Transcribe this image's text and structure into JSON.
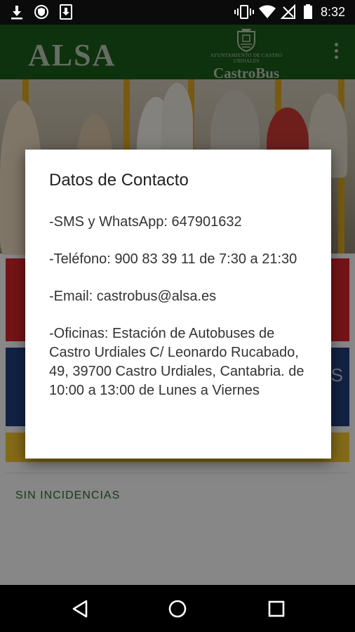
{
  "status_bar": {
    "time": "8:32",
    "left_icons": [
      "download-icon",
      "shield-icon",
      "save-icon"
    ],
    "right_icons": [
      "vibrate-icon",
      "wifi-icon",
      "no-signal-icon",
      "battery-icon"
    ]
  },
  "app_bar": {
    "brand": "ALSA",
    "partner_subtitle": "AYUNTAMIENTO DE CASTRO URDIALES",
    "partner_name": "CastroBus",
    "menu_icon": "overflow-menu-icon"
  },
  "background": {
    "blue_tile_text": "AS",
    "incidents_label": "SIN INCIDENCIAS"
  },
  "dialog": {
    "title": "Datos de Contacto",
    "lines": [
      "-SMS y WhatsApp: 647901632",
      "-Teléfono: 900 83 39 11 de 7:30 a 21:30",
      "-Email: castrobus@alsa.es",
      "-Oficinas: Estación de Autobuses de Castro Urdiales C/ Leonardo Rucabado, 49, 39700 Castro Urdiales, Cantabria. de 10:00 a 13:00 de Lunes a Viernes"
    ]
  },
  "nav_bar": {
    "buttons": [
      "back-icon",
      "home-icon",
      "recents-icon"
    ]
  },
  "colors": {
    "app_bar": "#1a5a1a",
    "tile_red": "#d6262b",
    "tile_blue": "#233f7c",
    "tile_yellow": "#f2c42e"
  }
}
